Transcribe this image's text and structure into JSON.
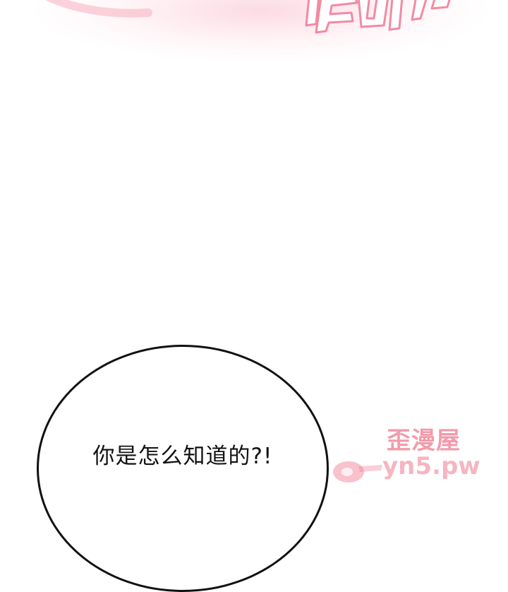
{
  "sfx": {
    "color": "#f28aa3",
    "glow_color": "#fbd0da"
  },
  "bubble": {
    "text": "你是怎么知道的?!"
  },
  "watermark": {
    "title": "歪漫屋",
    "url": "yn5.pw",
    "color": "#ef788e"
  }
}
